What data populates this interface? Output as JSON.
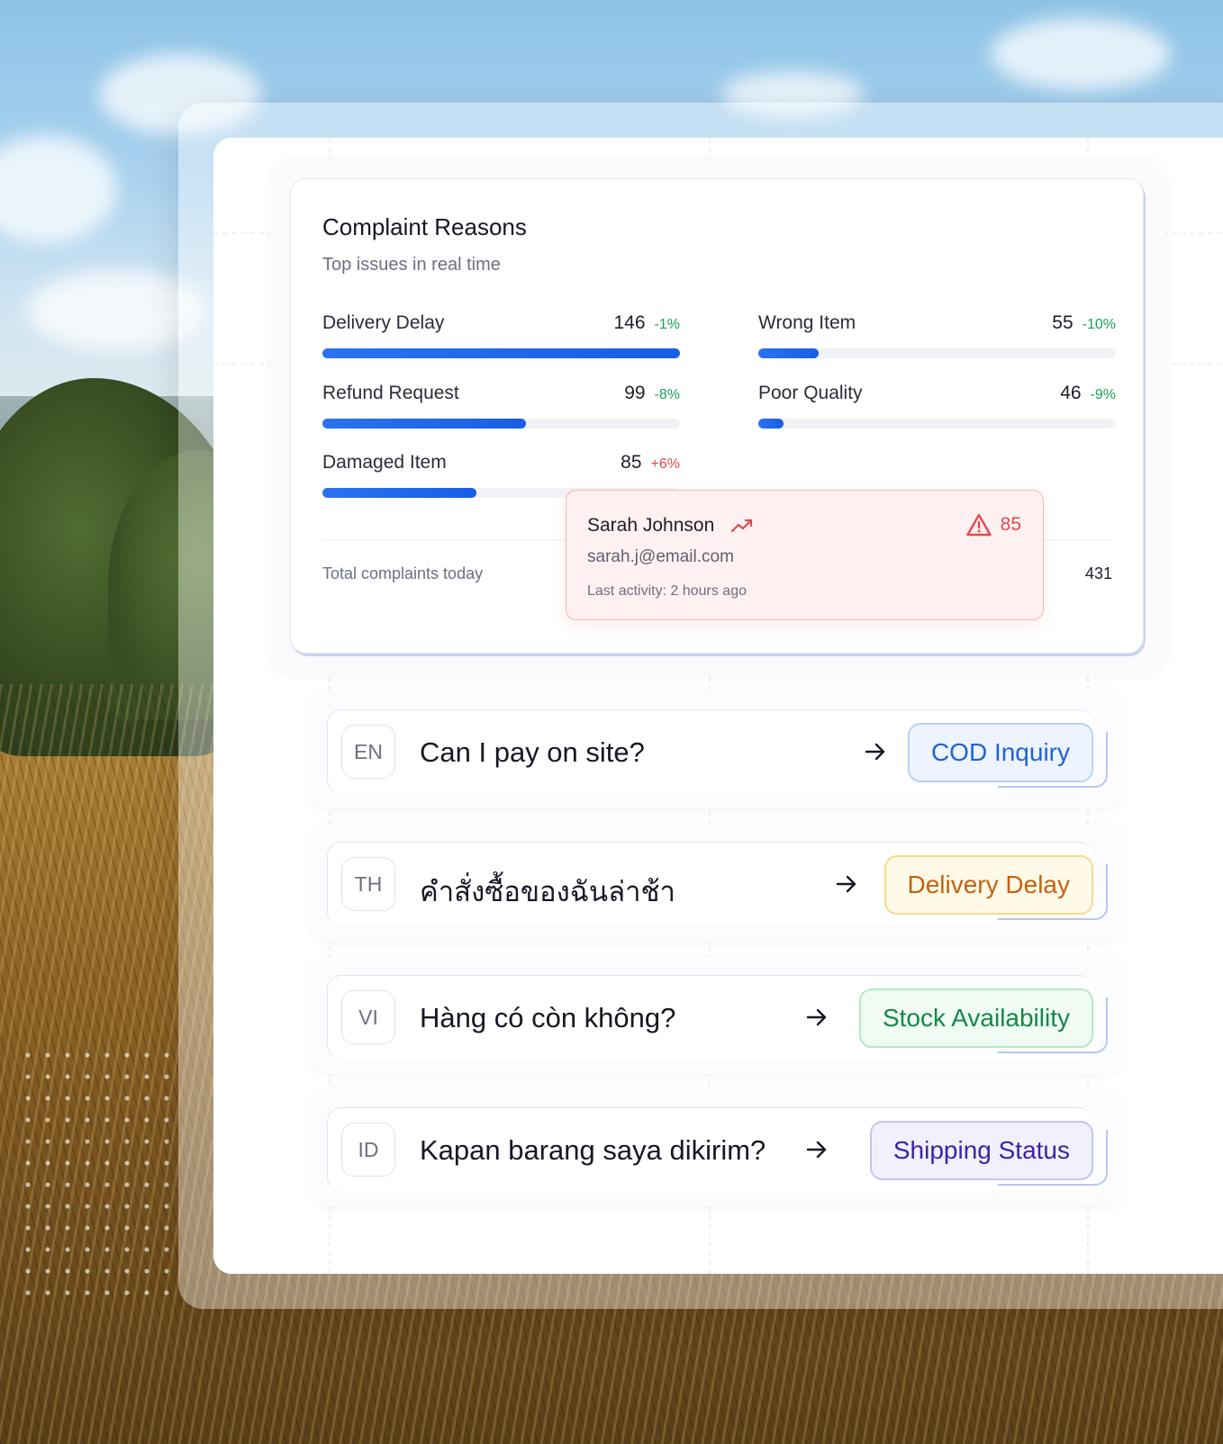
{
  "complaints": {
    "title": "Complaint Reasons",
    "subtitle": "Top issues in real time",
    "metrics": [
      {
        "label": "Delivery Delay",
        "value": "146",
        "change": "-1%",
        "trend": "down",
        "fill_fraction": 1.0
      },
      {
        "label": "Wrong Item",
        "value": "55",
        "change": "-10%",
        "trend": "down",
        "fill_fraction": 0.17
      },
      {
        "label": "Refund Request",
        "value": "99",
        "change": "-8%",
        "trend": "down",
        "fill_fraction": 0.57
      },
      {
        "label": "Poor Quality",
        "value": "46",
        "change": "-9%",
        "trend": "down",
        "fill_fraction": 0.07
      },
      {
        "label": "Damaged Item",
        "value": "85",
        "change": "+6%",
        "trend": "up",
        "fill_fraction": 0.43
      }
    ],
    "total_label": "Total complaints today",
    "total_value": "431"
  },
  "tooltip": {
    "name": "Sarah Johnson",
    "email": "sarah.j@email.com",
    "activity": "Last activity: 2 hours ago",
    "score": "85",
    "trend_icon": "trending-up-icon",
    "alert_icon": "warning-triangle-icon"
  },
  "queries": [
    {
      "lang": "EN",
      "text": "Can I pay on site?",
      "tag": "COD Inquiry",
      "color": "blue"
    },
    {
      "lang": "TH",
      "text": "คำสั่งซื้อของฉันล่าช้า",
      "tag": "Delivery Delay",
      "color": "yellow"
    },
    {
      "lang": "VI",
      "text": "Hàng có còn không?",
      "tag": "Stock Availability",
      "color": "green"
    },
    {
      "lang": "ID",
      "text": "Kapan barang saya dikirim?",
      "tag": "Shipping Status",
      "color": "purple"
    }
  ],
  "colors": {
    "accent": "#1a5de6",
    "positive": "#18a058",
    "negative": "#e5484d"
  }
}
